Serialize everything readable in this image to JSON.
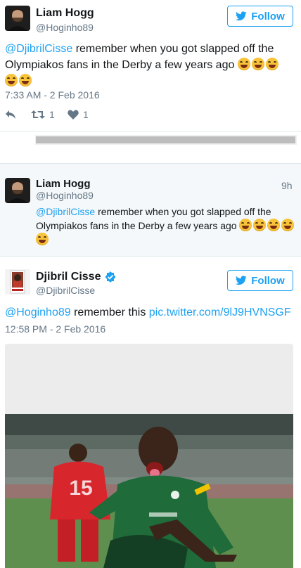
{
  "tweet1": {
    "name": "Liam Hogg",
    "handle": "@Hoginho89",
    "follow_label": "Follow",
    "mention": "@DjibrilCisse",
    "text": " remember when you got slapped off the Olympiakos fans in the Derby a few years ago",
    "timestamp": "7:33 AM - 2 Feb 2016",
    "retweets": "1",
    "likes": "1"
  },
  "quoted": {
    "name": "Liam Hogg",
    "handle": "@Hoginho89",
    "time": "9h",
    "mention": "@DjibrilCisse",
    "text": " remember when you got slapped off the Olympiakos fans in the Derby a few years ago"
  },
  "tweet2": {
    "name": "Djibril Cisse",
    "handle": "@DjibrilCisse",
    "follow_label": "Follow",
    "mention": "@Hoginho89",
    "text": " remember this ",
    "link": "pic.twitter.com/9lJ9HVNSGF",
    "timestamp": "12:58 PM - 2 Feb 2016",
    "photo_number": "15"
  },
  "colors": {
    "accent": "#1da1f2",
    "secondary_text": "#657786",
    "jersey_green": "#1f6b3a",
    "jersey_red": "#d8262d"
  },
  "icons": [
    "twitter-bird-icon",
    "reply-icon",
    "retweet-icon",
    "heart-icon",
    "verified-badge-icon",
    "laughing-emoji-icon"
  ]
}
